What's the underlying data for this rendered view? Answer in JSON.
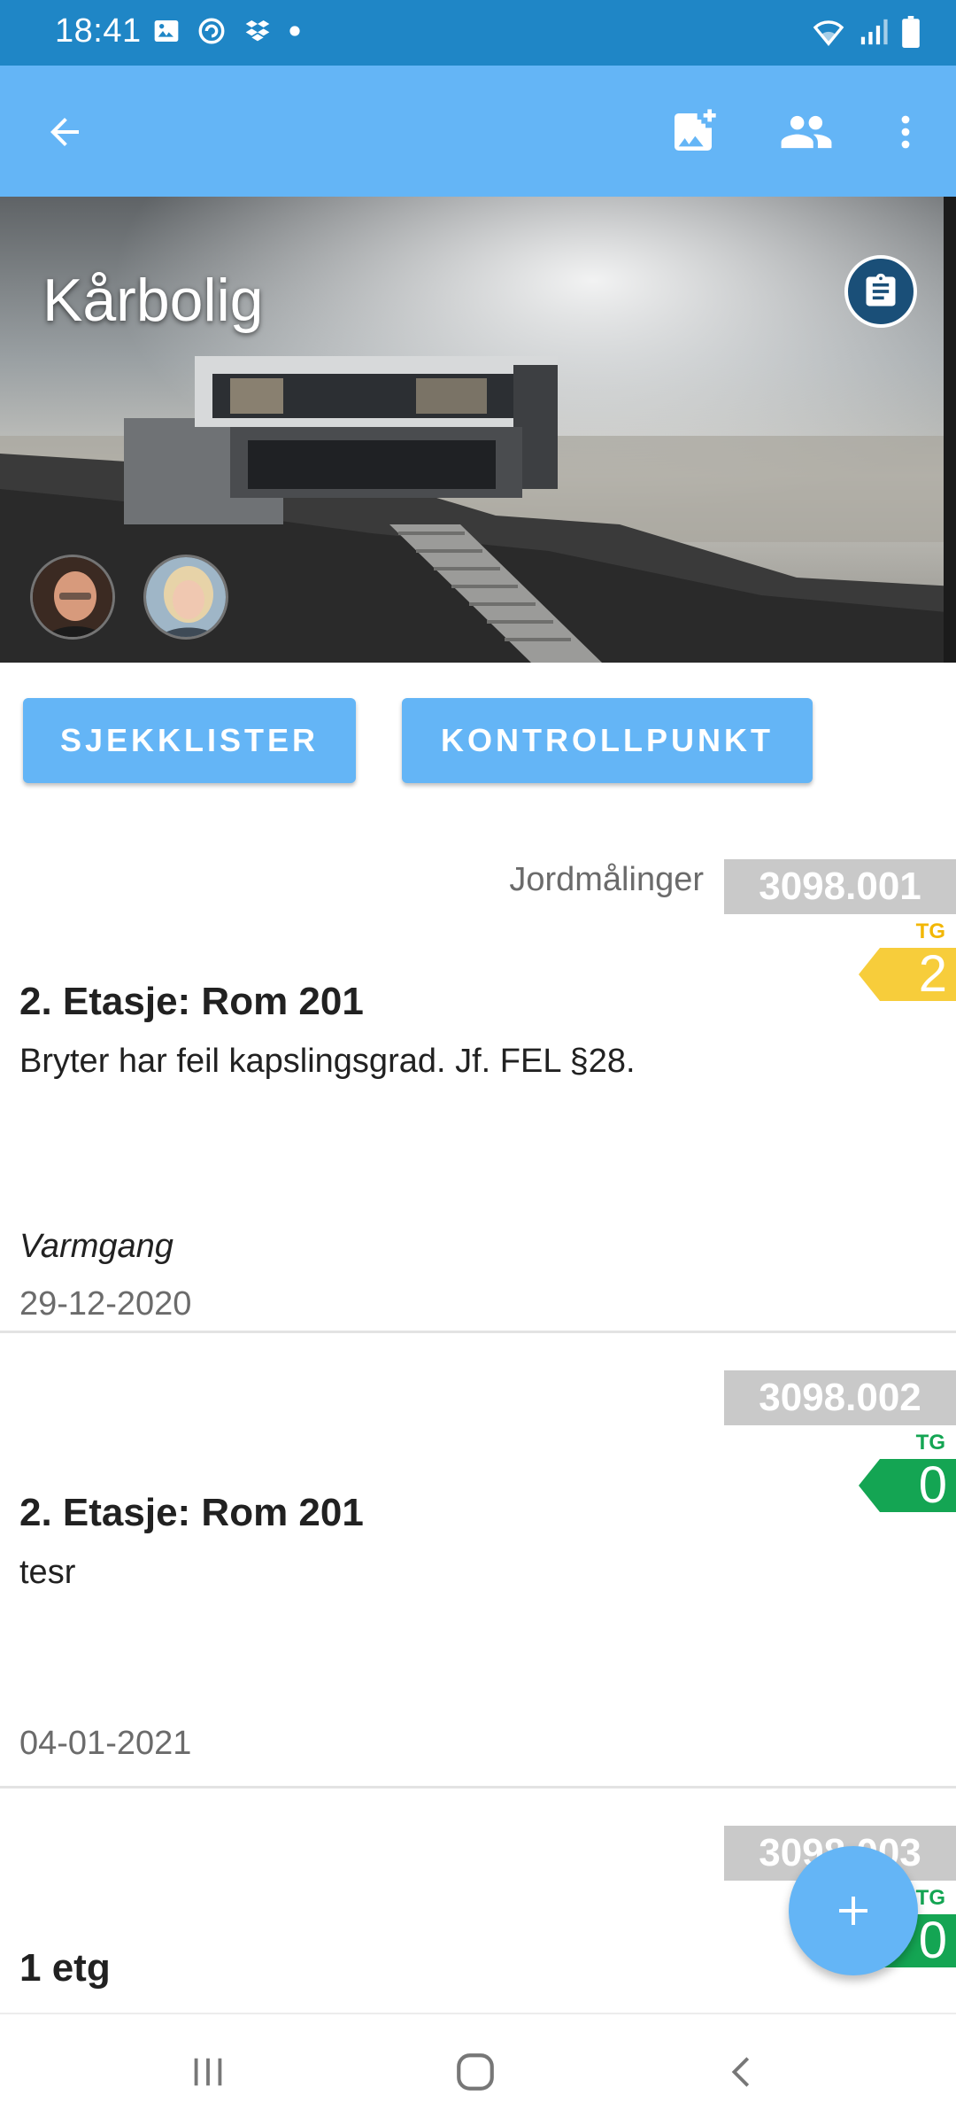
{
  "status_bar": {
    "time": "18:41",
    "left_icons": [
      "image-icon",
      "sync-icon",
      "dropbox-icon",
      "dot-icon"
    ],
    "right_icons": [
      "wifi-icon",
      "signal-icon",
      "battery-icon"
    ]
  },
  "app_bar": {
    "icons": [
      "back-arrow-icon",
      "add-photo-icon",
      "people-icon",
      "more-vert-icon"
    ]
  },
  "hero": {
    "title": "Kårbolig",
    "badge_icon": "clipboard-icon",
    "avatars": [
      "avatar-man",
      "avatar-woman"
    ]
  },
  "actions": {
    "checklists_label": "SJEKKLISTER",
    "checkpoint_label": "KONTROLLPUNKT"
  },
  "items": [
    {
      "category": "Jordmålinger",
      "code": "3098.001",
      "tg_label": "TG",
      "tg_value": "2",
      "tg_color": "#f7cd3b",
      "title": "2. Etasje: Rom 201",
      "description": "Bryter har feil kapslingsgrad. Jf. FEL §28.",
      "subtitle": "Varmgang",
      "date": "29-12-2020"
    },
    {
      "category": "",
      "code": "3098.002",
      "tg_label": "TG",
      "tg_value": "0",
      "tg_color": "#14a553",
      "title": "2. Etasje: Rom 201",
      "description": "tesr",
      "subtitle": "",
      "date": "04-01-2021"
    },
    {
      "category": "",
      "code": "3098.003",
      "tg_label": "TG",
      "tg_value": "0",
      "tg_color": "#14a553",
      "title": "1 etg",
      "description": "",
      "subtitle": "",
      "date": ""
    }
  ],
  "fab": {
    "icon": "plus-icon"
  },
  "nav_bar": {
    "icons": [
      "recents-icon",
      "home-icon",
      "back-icon"
    ]
  },
  "colors": {
    "status_bar": "#1f86c6",
    "primary": "#64b5f6",
    "code_badge": "#c9c9c9",
    "tg_green": "#14a553",
    "tg_yellow": "#f7cd3b"
  }
}
